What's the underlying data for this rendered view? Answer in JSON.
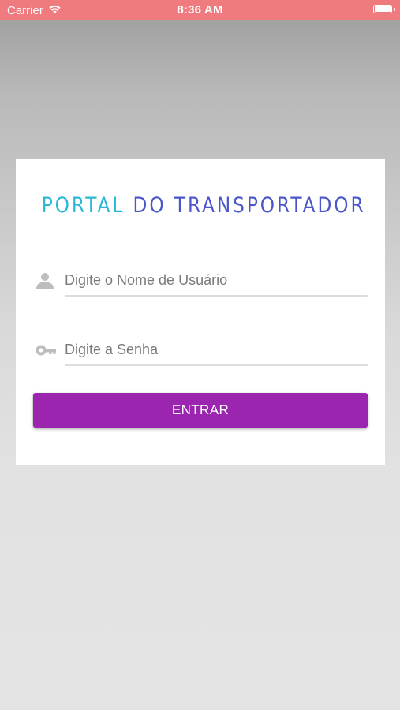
{
  "status_bar": {
    "carrier": "Carrier",
    "time": "8:36 AM",
    "background_color": "#f07b7e",
    "wifi_icon": "wifi-icon",
    "battery_icon": "battery-icon",
    "battery_level": 1.0
  },
  "login": {
    "title_part_1": "PORTAL",
    "title_part_2": "DO TRANSPORTADOR",
    "title_color_1": "#2bb8d6",
    "title_color_2": "#4a56c9",
    "username": {
      "placeholder": "Digite o Nome de Usuário",
      "value": "",
      "icon": "person-icon"
    },
    "password": {
      "placeholder": "Digite a Senha",
      "value": "",
      "icon": "key-icon"
    },
    "submit_label": "ENTRAR",
    "submit_color": "#9c25b0"
  }
}
